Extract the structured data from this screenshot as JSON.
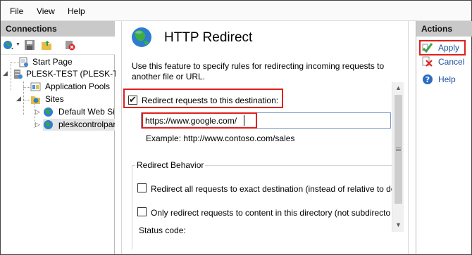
{
  "menu": [
    "File",
    "View",
    "Help"
  ],
  "connections": {
    "title": "Connections",
    "tree": [
      {
        "label": "Start Page"
      },
      {
        "label": "PLESK-TEST (PLESK-TE"
      },
      {
        "label": "Application Pools"
      },
      {
        "label": "Sites"
      },
      {
        "label": "Default Web Sit"
      },
      {
        "label": "pleskcontrolpar"
      }
    ]
  },
  "page": {
    "title": "HTTP Redirect",
    "description": "Use this feature to specify rules for redirecting incoming requests to another file or URL.",
    "redirect_checkbox_label": "Redirect requests to this destination:",
    "redirect_checked": true,
    "destination_value": "https://www.google.com/",
    "example": "Example: http://www.contoso.com/sales",
    "behavior_group": "Redirect Behavior",
    "option_exact": "Redirect all requests to exact destination (instead of relative to de",
    "option_only_dir": "Only redirect requests to content in this directory (not subdirecto",
    "status_code_label": "Status code:"
  },
  "actions": {
    "title": "Actions",
    "apply": "Apply",
    "cancel": "Cancel",
    "help": "Help"
  },
  "colors": {
    "highlight_red": "#e0201c",
    "link_blue": "#1c4f9c",
    "panel_header": "#c9c9c9"
  }
}
